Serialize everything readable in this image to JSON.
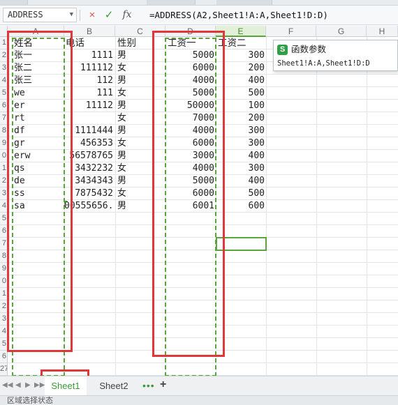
{
  "formula_bar": {
    "name_box": "ADDRESS",
    "cancel_icon": "×",
    "enter_icon": "✓",
    "fx_label": "fx",
    "formula": "=ADDRESS(A2,Sheet1!A:A,Sheet1!D:D)"
  },
  "columns": [
    "A",
    "B",
    "C",
    "D",
    "E",
    "F",
    "G",
    "H"
  ],
  "selected_column": "E",
  "row_numbers": [
    "1",
    "2",
    "3",
    "4",
    "5",
    "6",
    "7",
    "8",
    "9",
    "0",
    "1",
    "2",
    "3",
    "4",
    "5",
    "6",
    "7",
    "8",
    "9",
    "0",
    "1",
    "2",
    "3",
    "4",
    "5",
    "6",
    "27"
  ],
  "table": {
    "headers": [
      "姓名",
      "电话",
      "性别",
      "工资一",
      "工资二"
    ],
    "rows": [
      [
        "张一",
        "1111",
        "男",
        "5000",
        "300"
      ],
      [
        "张二",
        "111112",
        "女",
        "6000",
        "200"
      ],
      [
        "张三",
        "112",
        "男",
        "4000",
        "400"
      ],
      [
        "we",
        "111",
        "女",
        "5000",
        "500"
      ],
      [
        "er",
        "11112",
        "男",
        "50000",
        "100"
      ],
      [
        "rt",
        "",
        "女",
        "7000",
        "200"
      ],
      [
        "df",
        "1111444",
        "男",
        "4000",
        "300"
      ],
      [
        "gr",
        "456353",
        "女",
        "6000",
        "300"
      ],
      [
        "erw",
        "56578765",
        "男",
        "3000",
        "400"
      ],
      [
        "qs",
        "3432232",
        "女",
        "4000",
        "300"
      ],
      [
        "de",
        "3434343",
        "男",
        "5000",
        "400"
      ],
      [
        "ss",
        "7875432",
        "女",
        "6000",
        "500"
      ],
      [
        "sa",
        "00555656.",
        "男",
        "6001",
        "600"
      ]
    ]
  },
  "tooltip": {
    "title": "函数参数",
    "logo": "S",
    "hint": "Sheet1!A:A,Sheet1!D:D"
  },
  "sheets": {
    "tabs": [
      "Sheet1",
      "Sheet2"
    ],
    "active": "Sheet1",
    "more_icon": "•••",
    "add_icon": "+"
  },
  "status": {
    "text": "区域选择状态"
  },
  "colors": {
    "accent_green": "#5aa53b",
    "highlight_red": "#e0373a"
  }
}
